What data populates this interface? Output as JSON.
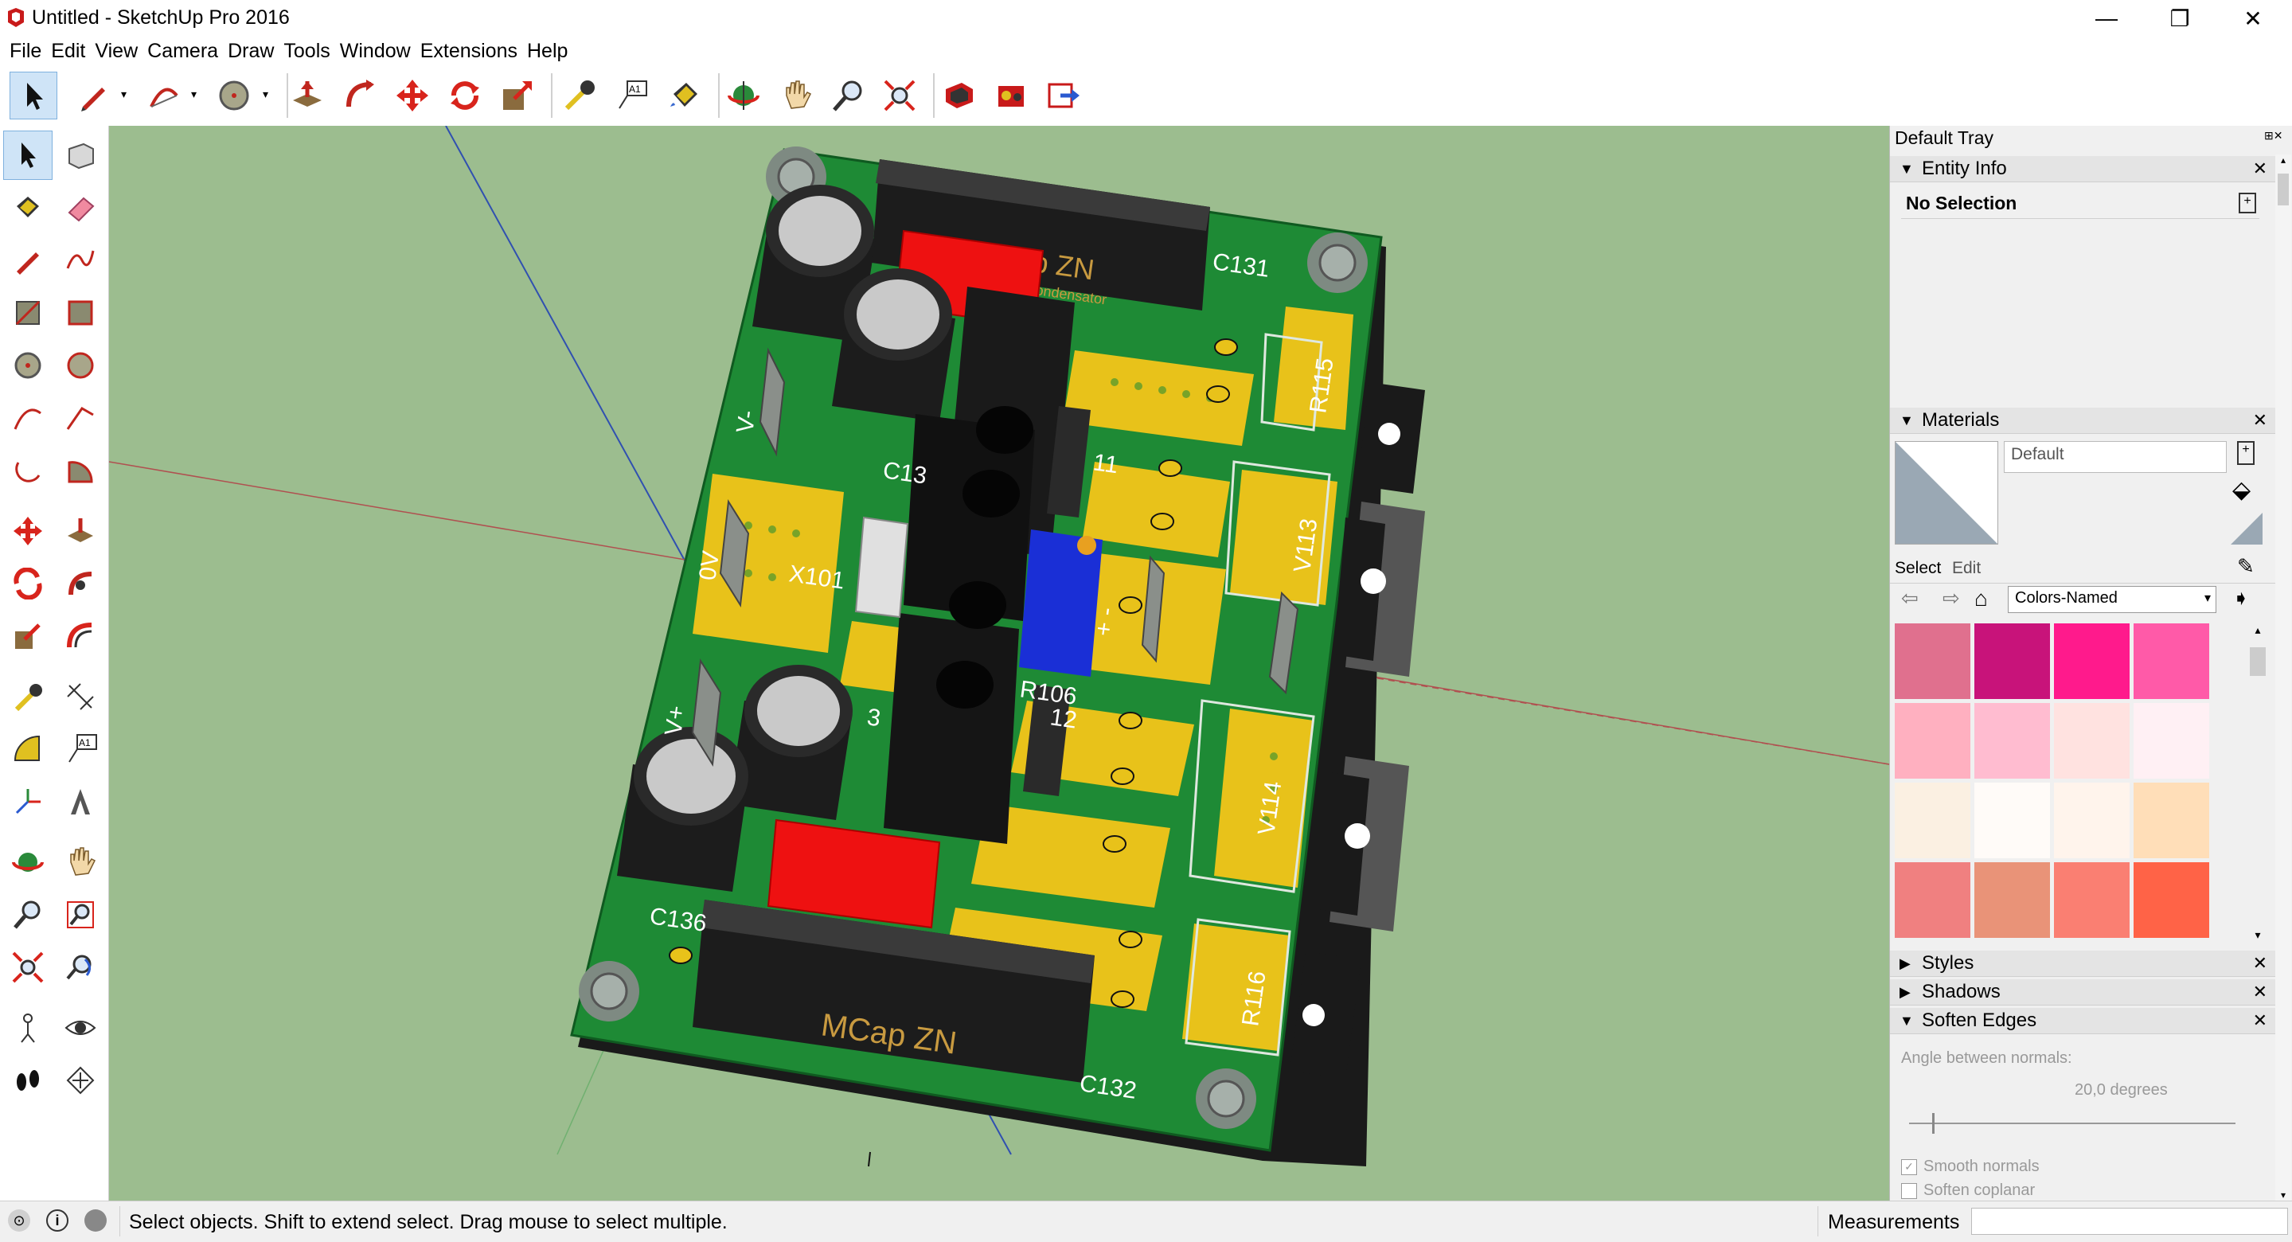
{
  "app": {
    "title": "Untitled - SketchUp Pro 2016",
    "window_controls": {
      "minimize": "—",
      "restore": "❐",
      "close": "✕"
    }
  },
  "menu": [
    "File",
    "Edit",
    "View",
    "Camera",
    "Draw",
    "Tools",
    "Window",
    "Extensions",
    "Help"
  ],
  "toolbar": {
    "icons": [
      "select-icon",
      "pencil-icon",
      "arc-icon",
      "circle-icon",
      "push-pull-icon",
      "follow-me-icon",
      "move-icon",
      "rotate-icon",
      "scale-icon",
      "tape-measure-icon",
      "text-icon",
      "paint-bucket-icon",
      "orbit-icon",
      "pan-icon",
      "zoom-icon",
      "zoom-extents-icon",
      "warehouse-icon",
      "extension-warehouse-icon",
      "send-to-layout-icon"
    ],
    "text_tool_label": "A1"
  },
  "left_toolbar": {
    "icons": [
      "select-icon",
      "component-icon",
      "paint-bucket-icon",
      "eraser-icon",
      "line-icon",
      "freehand-icon",
      "rectangle-icon",
      "rotated-rectangle-icon",
      "circle-icon",
      "polygon-icon",
      "arc-icon",
      "two-point-arc-icon",
      "three-point-arc-icon",
      "pie-icon",
      "move-icon",
      "push-pull-icon",
      "rotate-icon",
      "follow-me-icon",
      "scale-icon",
      "offset-icon",
      "tape-measure-icon",
      "dimension-icon",
      "protractor-icon",
      "text-icon",
      "axes-icon",
      "3d-text-icon",
      "orbit-icon",
      "pan-icon",
      "zoom-icon",
      "zoom-window-icon",
      "zoom-extents-icon",
      "previous-view-icon",
      "position-camera-icon",
      "look-around-icon",
      "walk-icon",
      "section-plane-icon"
    ],
    "text_tool_label": "A1"
  },
  "model": {
    "labels": {
      "cap_top_brand": "MCap ZN",
      "cap_top_sub": "ondensator",
      "cap_bottom_brand": "MCap ZN",
      "c131": "C131",
      "c132": "C132",
      "c136": "C136",
      "c13x": "C13",
      "r115": "R115",
      "r116": "R116",
      "r106": "R106",
      "v113": "V113",
      "v114": "V114",
      "x101": "X101",
      "v_minus": "V-",
      "v_plus": "V+",
      "zero_v": "0V",
      "n11": "11",
      "n12": "12",
      "n3": "3",
      "plus_minus": "+ -"
    },
    "colors": {
      "pcb": "#1e8a35",
      "pad": "#e8c21a",
      "cap_body": "#1c1c1c",
      "red_cap": "#ee1111",
      "blue_trim": "#1a2fd6",
      "background": "#9cbd8f"
    }
  },
  "tray": {
    "title": "Default Tray",
    "entity_info": {
      "label": "Entity Info",
      "value": "No Selection"
    },
    "materials": {
      "label": "Materials",
      "current": "Default",
      "tab_select": "Select",
      "tab_edit": "Edit",
      "library": "Colors-Named",
      "swatches": [
        "#e0708e",
        "#c8137a",
        "#ff1a8c",
        "#ff5aa8",
        "#ffb0c0",
        "#ffbcd0",
        "#ffe2e0",
        "#fff0f4",
        "#fbf0e2",
        "#fffbf8",
        "#fff4ec",
        "#ffdeb8",
        "#f08080",
        "#e99378",
        "#fa7f72",
        "#ff6347"
      ]
    },
    "styles": {
      "label": "Styles"
    },
    "shadows": {
      "label": "Shadows"
    },
    "soften_edges": {
      "label": "Soften Edges",
      "angle_label": "Angle between normals:",
      "angle_value": "20,0  degrees",
      "angle_fraction": 0.2,
      "smooth_normals": "Smooth normals",
      "soften_coplanar": "Soften coplanar"
    }
  },
  "status": {
    "message": "Select objects. Shift to extend select. Drag mouse to select multiple.",
    "measurements_label": "Measurements",
    "icons": [
      "geo-location-icon",
      "info-icon",
      "user-icon"
    ]
  }
}
